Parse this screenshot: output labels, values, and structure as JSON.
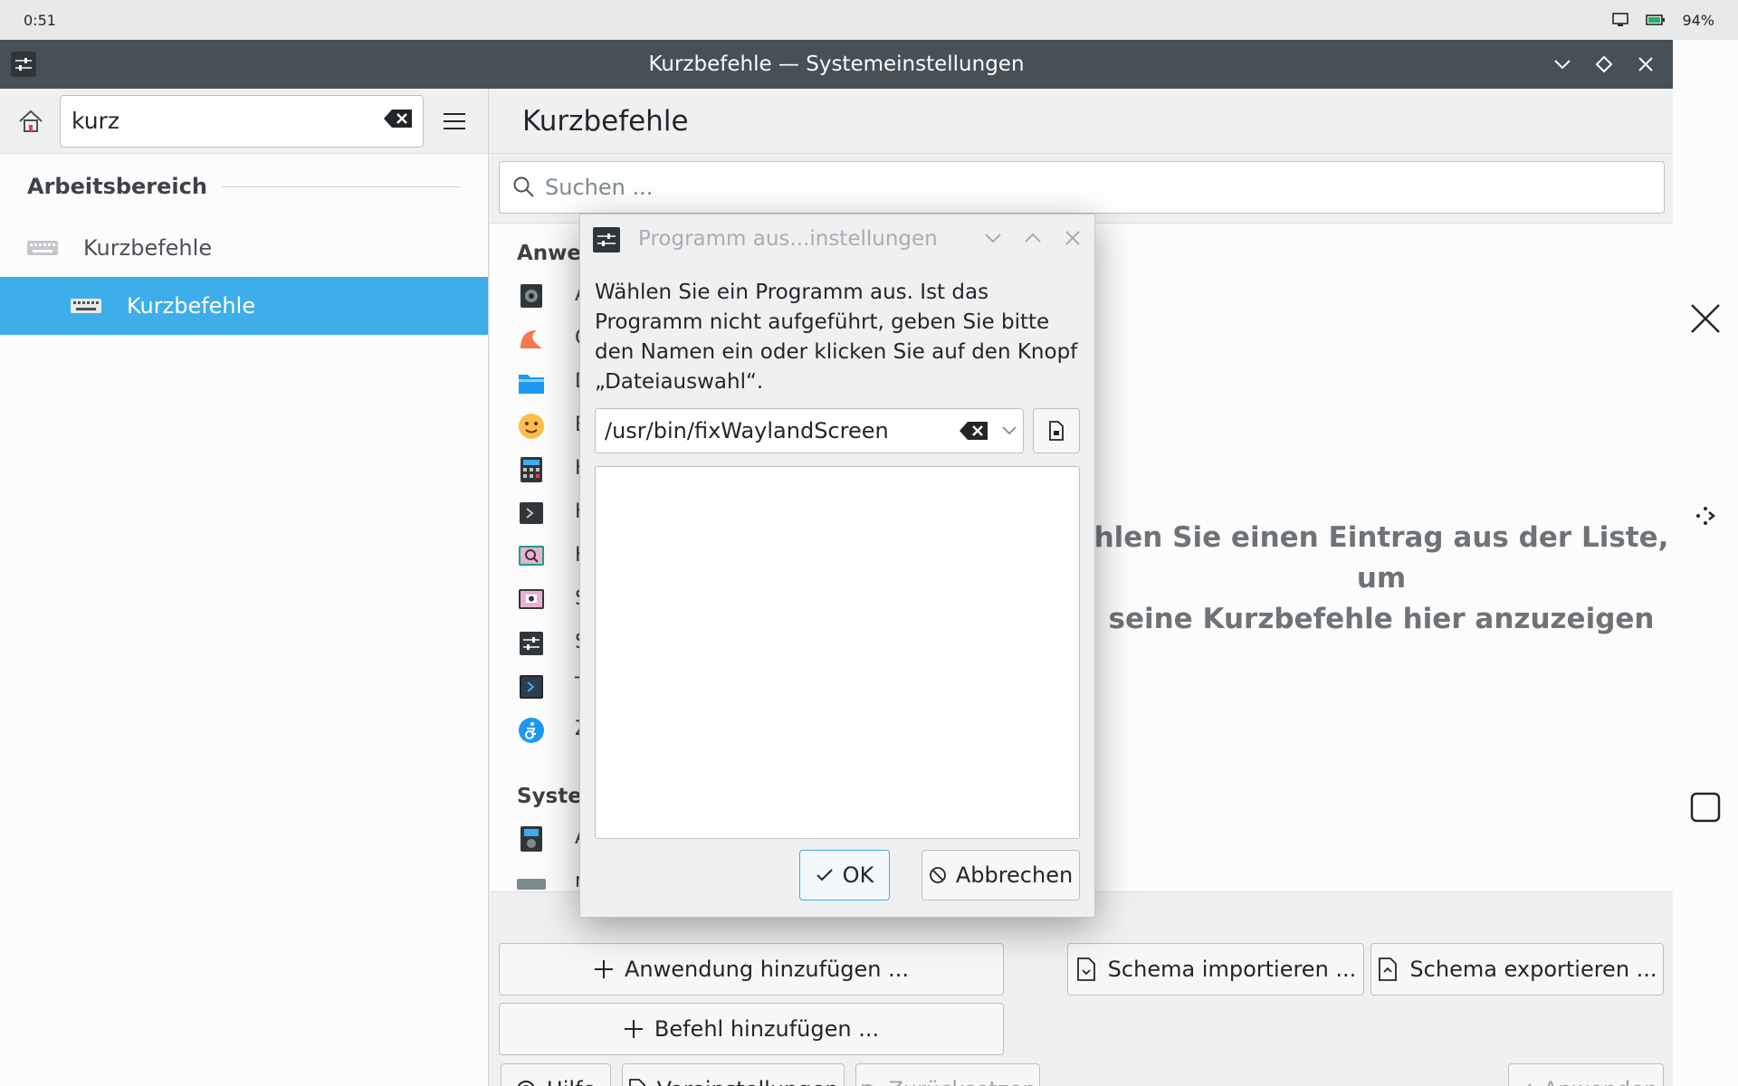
{
  "status_bar": {
    "time": "0:51",
    "battery": "94%"
  },
  "window": {
    "title": "Kurzbefehle — Systemeinstellungen"
  },
  "sidebar": {
    "search_value": "kurz",
    "section": "Arbeitsbereich",
    "items": [
      {
        "label": "Kurzbefehle"
      },
      {
        "label": "Kurzbefehle"
      }
    ]
  },
  "content": {
    "title": "Kurzbefehle",
    "search_placeholder": "Suchen ...",
    "categories": [
      "Anwe",
      "Syster"
    ],
    "placeholder_line1": "hlen Sie einen Eintrag aus der Liste, um",
    "placeholder_line2": "seine Kurzbefehle hier anzuzeigen",
    "app_letters": [
      "A",
      "C",
      "D",
      "E",
      "K",
      "K",
      "K",
      "S",
      "S",
      "T",
      "Z",
      "A",
      "r"
    ],
    "buttons": {
      "add_app": "Anwendung hinzufügen ...",
      "add_command": "Befehl hinzufügen ...",
      "import": "Schema importieren ...",
      "export": "Schema exportieren ...",
      "help": "Hilfe",
      "defaults": "Voreinstellungen",
      "reset": "Zurücksetzen",
      "apply": "Anwenden"
    }
  },
  "dialog": {
    "title": "Programm aus...instellungen",
    "message": "Wählen Sie ein Programm aus. Ist das Programm nicht aufgeführt, geben Sie bitte den Namen ein oder klicken Sie auf den Knopf „Dateiauswahl“.",
    "path_value": "/usr/bin/fixWaylandScreen",
    "ok": "OK",
    "cancel": "Abbrechen"
  },
  "colors": {
    "accent": "#3daee9",
    "titlebar": "#475057",
    "background": "#eff0f1"
  }
}
